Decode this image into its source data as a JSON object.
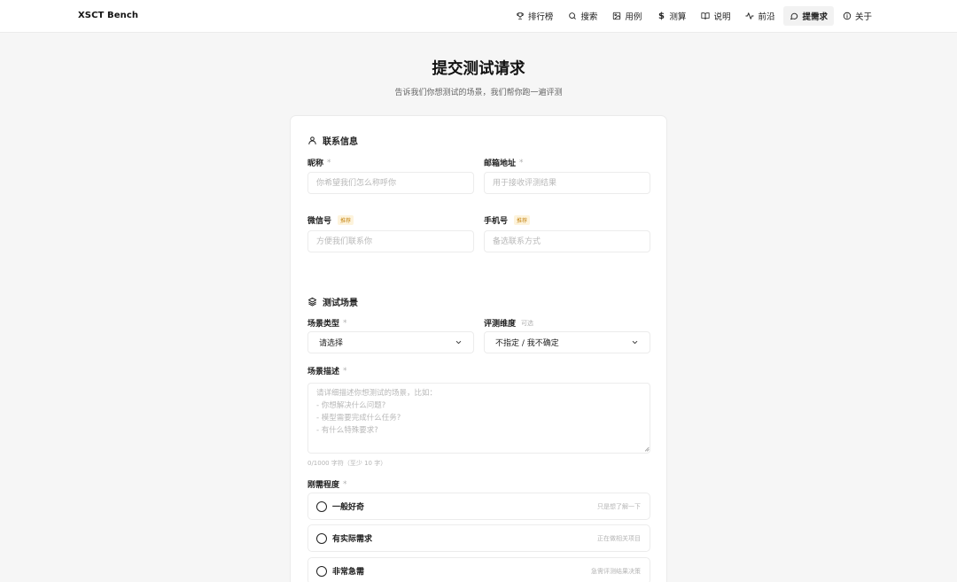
{
  "header": {
    "brand": "XSCT Bench",
    "nav": [
      {
        "label": "排行榜",
        "icon": "trophy-icon"
      },
      {
        "label": "搜索",
        "icon": "search-icon"
      },
      {
        "label": "用例",
        "icon": "image-icon"
      },
      {
        "label": "测算",
        "icon": "dollar-icon"
      },
      {
        "label": "说明",
        "icon": "book-icon"
      },
      {
        "label": "前沿",
        "icon": "activity-icon"
      },
      {
        "label": "提需求",
        "icon": "message-icon",
        "active": true
      },
      {
        "label": "关于",
        "icon": "info-icon"
      }
    ]
  },
  "page": {
    "title": "提交测试请求",
    "subtitle": "告诉我们你想测试的场景，我们帮你跑一遍评测"
  },
  "contact": {
    "section_title": "联系信息",
    "nickname_label": "昵称",
    "nickname_placeholder": "你希望我们怎么称呼你",
    "email_label": "邮箱地址",
    "email_placeholder": "用于接收评测结果",
    "wechat_label": "微信号",
    "wechat_tag": "推荐",
    "wechat_placeholder": "方便我们联系你",
    "phone_label": "手机号",
    "phone_tag": "推荐",
    "phone_placeholder": "备选联系方式",
    "required_mark": "*"
  },
  "scenario": {
    "section_title": "测试场景",
    "type_label": "场景类型",
    "type_value": "请选择",
    "dimension_label": "评测维度",
    "dimension_tag": "可选",
    "dimension_value": "不指定 / 我不确定",
    "desc_label": "场景描述",
    "desc_placeholder": "请详细描述你想测试的场景，比如：\n- 你想解决什么问题?\n- 模型需要完成什么任务?\n- 有什么特殊要求?",
    "counter": "0/1000 字符（至少 10 字）",
    "urgency_label": "刚需程度",
    "urgency_options": [
      {
        "label": "一般好奇",
        "hint": "只是想了解一下"
      },
      {
        "label": "有实际需求",
        "hint": "正在做相关项目"
      },
      {
        "label": "非常急需",
        "hint": "急需评测结果决策"
      }
    ]
  }
}
